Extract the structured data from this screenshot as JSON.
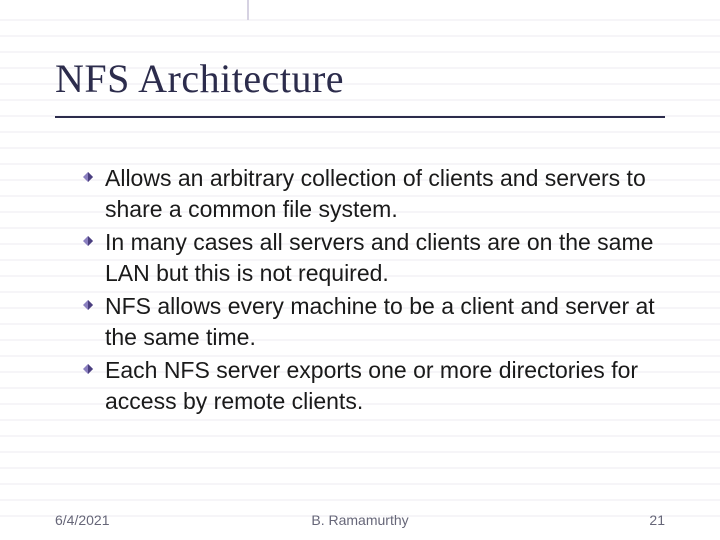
{
  "title": "NFS Architecture",
  "bullets": [
    "Allows an arbitrary collection of clients and servers to share a common file system.",
    "In many cases all servers and clients are on the same LAN but this is not required.",
    "NFS allows every machine to be a client and server at the same time.",
    "Each NFS server exports one or more directories for access by remote clients."
  ],
  "footer": {
    "date": "6/4/2021",
    "author": "B. Ramamurthy",
    "page": "21"
  },
  "colors": {
    "title": "#2c2c4c",
    "rule": "#e6e6ee",
    "accent": "#8a7fbf"
  }
}
